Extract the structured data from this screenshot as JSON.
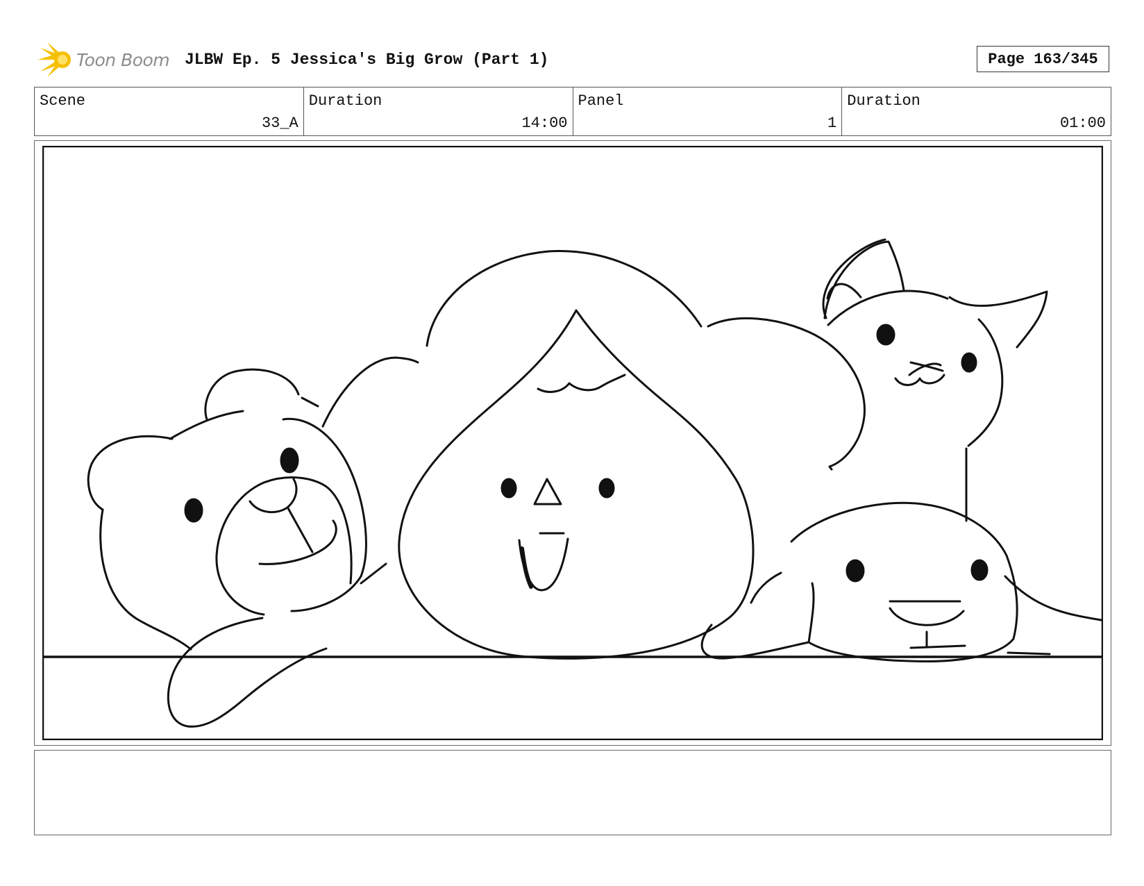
{
  "header": {
    "logo_text": "Toon Boom",
    "title": "JLBW Ep. 5 Jessica's Big Grow (Part 1)",
    "page": "Page 163/345"
  },
  "info": {
    "scene_label": "Scene",
    "scene_value": "33_A",
    "scene_duration_label": "Duration",
    "scene_duration_value": "14:00",
    "panel_label": "Panel",
    "panel_value": "1",
    "panel_duration_label": "Duration",
    "panel_duration_value": "01:00"
  },
  "colors": {
    "logo_accent": "#f5c000",
    "logo_text": "#8c8c8c",
    "ink": "#111111"
  },
  "icons": [
    "toon-boom-logo-icon"
  ],
  "panel": {
    "content": "pencil sketch",
    "notes": ""
  }
}
